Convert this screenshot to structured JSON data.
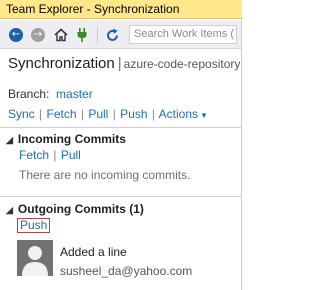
{
  "window": {
    "title": "Team Explorer - Synchronization"
  },
  "toolbar": {
    "icons": [
      "back-icon",
      "forward-icon",
      "home-icon",
      "connect-icon",
      "refresh-icon"
    ],
    "search_placeholder": "Search Work Items (",
    "colors": {
      "back": "#1f5ea8",
      "forward": "#a0a0a0",
      "connect": "#3a8a2a",
      "refresh": "#1f5ea8"
    }
  },
  "header": {
    "title": "Synchronization",
    "divider": "|",
    "project": "azure-code-repository"
  },
  "branch": {
    "label": "Branch:",
    "name": "master"
  },
  "actions": {
    "sync": "Sync",
    "fetch": "Fetch",
    "pull": "Pull",
    "push": "Push",
    "more": "Actions"
  },
  "incoming": {
    "title": "Incoming Commits",
    "fetch": "Fetch",
    "pull": "Pull",
    "empty": "There are no incoming commits."
  },
  "outgoing": {
    "title": "Outgoing Commits (1)",
    "push": "Push",
    "commits": [
      {
        "message": "Added a line",
        "author": "susheel_da@yahoo.com"
      }
    ]
  },
  "pipe": "|"
}
